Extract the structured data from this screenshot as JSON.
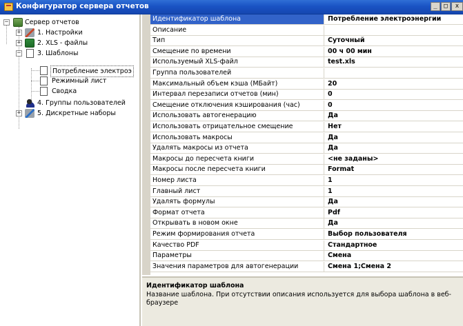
{
  "window": {
    "title": "Конфигуратор сервера отчетов",
    "buttons": {
      "minimize": "_",
      "maximize": "□",
      "close": "x"
    }
  },
  "tree": {
    "root": "Сервер отчетов",
    "items": [
      {
        "label": "1. Настройки",
        "expander": "+"
      },
      {
        "label": "2. XLS - файлы",
        "expander": "+"
      },
      {
        "label": "3. Шаблоны",
        "expander": "−"
      },
      {
        "label": "Потребление электроэ"
      },
      {
        "label": "Режимный лист"
      },
      {
        "label": "Сводка"
      },
      {
        "label": "4. Группы пользователей"
      },
      {
        "label": "5. Дискретные наборы",
        "expander": "+"
      }
    ],
    "root_expander": "−",
    "scroll_left": "◄",
    "scroll_right": "►"
  },
  "properties": [
    {
      "name": "Идентификатор шаблона",
      "value": "Потребление электроэнергии"
    },
    {
      "name": "Описание",
      "value": ""
    },
    {
      "name": "Тип",
      "value": "Суточный"
    },
    {
      "name": "Смещение по времени",
      "value": "00 ч 00 мин"
    },
    {
      "name": "Используемый XLS-файл",
      "value": "test.xls"
    },
    {
      "name": "Группа пользователей",
      "value": ""
    },
    {
      "name": "Максимальный объем кэша (МБайт)",
      "value": "20"
    },
    {
      "name": "Интервал перезаписи отчетов (мин)",
      "value": "0"
    },
    {
      "name": "Смещение отключения кэширования (час)",
      "value": "0"
    },
    {
      "name": "Использовать автогенерацию",
      "value": "Да"
    },
    {
      "name": "Использовать отрицательное смещение",
      "value": "Нет"
    },
    {
      "name": "Использовать макросы",
      "value": "Да"
    },
    {
      "name": "Удалять макросы из отчета",
      "value": "Да"
    },
    {
      "name": "Макросы до пересчета книги",
      "value": "<не заданы>"
    },
    {
      "name": "Макросы после пересчета книги",
      "value": "Format"
    },
    {
      "name": "Номер листа",
      "value": "1"
    },
    {
      "name": "Главный лист",
      "value": "1"
    },
    {
      "name": "Удалять формулы",
      "value": "Да"
    },
    {
      "name": "Формат отчета",
      "value": "Pdf"
    },
    {
      "name": "Открывать в новом окне",
      "value": "Да"
    },
    {
      "name": "Режим формирования отчета",
      "value": "Выбор пользователя"
    },
    {
      "name": "Качество PDF",
      "value": "Стандартное"
    },
    {
      "name": "Параметры",
      "value": "Смена"
    },
    {
      "name": "Значения параметров для автогенерации",
      "value": "Смена 1;Смена 2"
    }
  ],
  "description": {
    "title": "Идентификатор шаблона",
    "text": "Название шаблона. При отсутствии описания используется для выбора шаблона в веб-браузере"
  }
}
